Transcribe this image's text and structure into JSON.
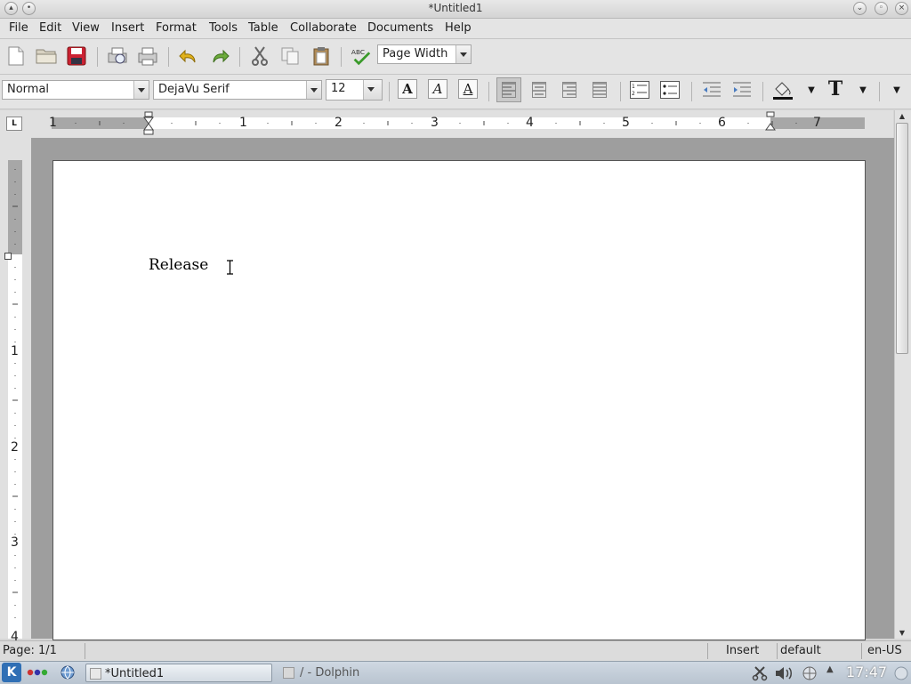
{
  "window": {
    "title": "*Untitled1"
  },
  "menu": [
    "File",
    "Edit",
    "View",
    "Insert",
    "Format",
    "Tools",
    "Table",
    "Collaborate",
    "Documents",
    "Help"
  ],
  "toolbar": {
    "zoom_value": "Page Width",
    "icons": [
      "new-document-icon",
      "open-folder-icon",
      "save-icon",
      "print-preview-icon",
      "print-icon",
      "undo-icon",
      "redo-icon",
      "cut-icon",
      "copy-icon",
      "paste-icon",
      "spellcheck-icon"
    ]
  },
  "format_toolbar": {
    "style_value": "Normal",
    "font_value": "DejaVu Serif",
    "size_value": "12",
    "bold_label": "A",
    "italic_label": "A",
    "underline_label": "A",
    "text_color_label": "T"
  },
  "ruler": {
    "numbers": [
      "1",
      "1",
      "2",
      "3",
      "4",
      "5",
      "6",
      "7"
    ]
  },
  "vruler": {
    "numbers": [
      "1",
      "2",
      "3",
      "4"
    ]
  },
  "document": {
    "text": "Release"
  },
  "status": {
    "page": "Page: 1/1",
    "mode": "Insert",
    "style": "default",
    "language": "en-US"
  },
  "taskbar": {
    "task1": "*Untitled1",
    "task2": "/ - Dolphin",
    "clock": "17:47"
  }
}
